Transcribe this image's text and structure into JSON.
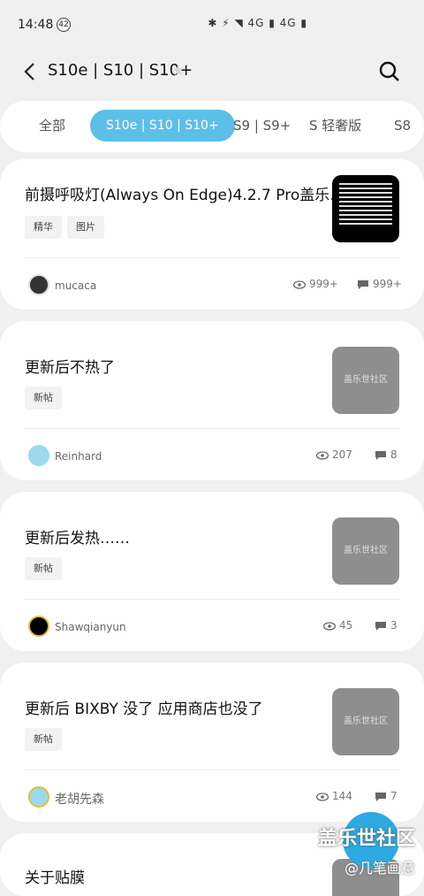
{
  "status": {
    "time": "14:48",
    "badge": "42",
    "right": "✱ ⚡ ◥ 4G ▮ 4G ▮"
  },
  "header": {
    "title": "S10e | S10 | S10+"
  },
  "tabs": [
    {
      "label": "全部",
      "active": false
    },
    {
      "label": "S10e | S10 | S10+",
      "active": true
    },
    {
      "label": "S9 | S9+",
      "active": false
    },
    {
      "label": "S 轻奢版",
      "active": false
    },
    {
      "label": "S8",
      "active": false
    }
  ],
  "posts": [
    {
      "title": "前摄呼吸灯(Always On Edge)4.2.7 Pro盖乐…",
      "tags": [
        "精华",
        "图片"
      ],
      "author": "mucaca",
      "views": "999+",
      "replies": "999+"
    },
    {
      "title": "更新后不热了",
      "tags": [
        "新帖"
      ],
      "thumb_text": "盖乐世社区",
      "author": "Reinhard",
      "views": "207",
      "replies": "8"
    },
    {
      "title": "更新后发热……",
      "tags": [
        "新帖"
      ],
      "thumb_text": "盖乐世社区",
      "author": "Shawqianyun",
      "views": "45",
      "replies": "3"
    },
    {
      "title": "更新后 BIXBY 没了  应用商店也没了",
      "tags": [
        "新帖"
      ],
      "thumb_text": "盖乐世社区",
      "author": "老胡先森",
      "views": "144",
      "replies": "7"
    },
    {
      "title": "关于贴膜"
    }
  ],
  "watermark": {
    "line1": "盖乐世社区",
    "line2": "@几笔画意"
  },
  "colors": {
    "accent": "#5cbfe8",
    "background": "#f0f0f0",
    "card": "#ffffff"
  }
}
